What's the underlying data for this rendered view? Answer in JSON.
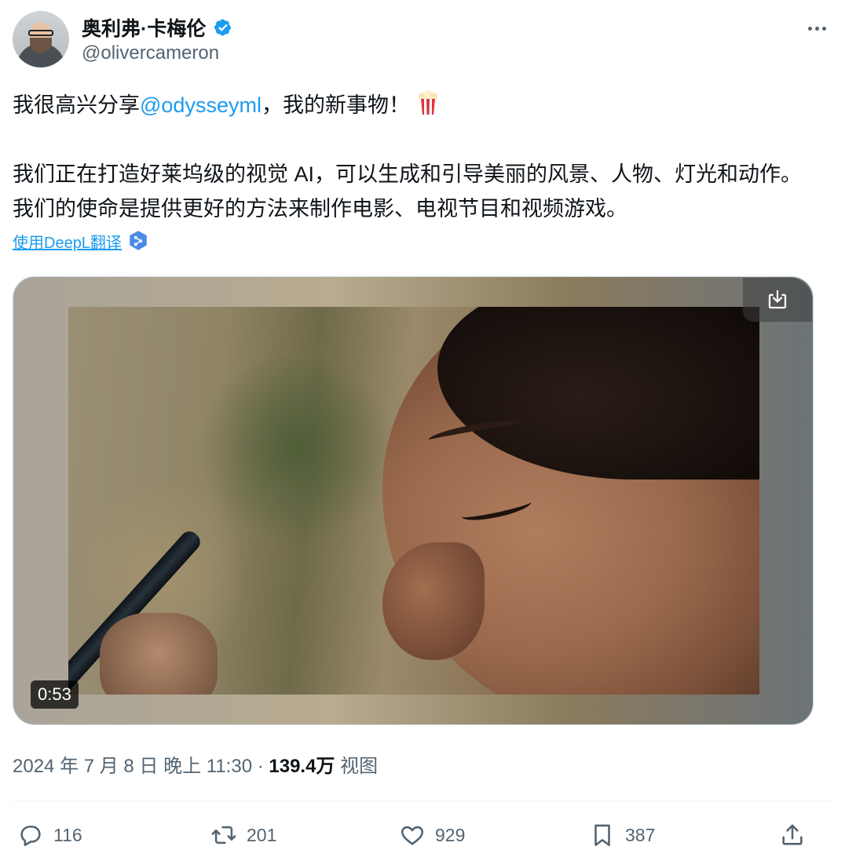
{
  "author": {
    "name": "奥利弗·卡梅伦",
    "handle": "@olivercameron",
    "verified_color": "#1d9bf0"
  },
  "tweet": {
    "text_part1": "我很高兴分享",
    "mention": "@odysseyml",
    "text_part2": "，我的新事物！",
    "emoji": "popcorn-icon",
    "paragraph2": "我们正在打造好莱坞级的视觉 AI，可以生成和引导美丽的风景、人物、灯光和动作。我们的使命是提供更好的方法来制作电影、电视节目和视频游戏。"
  },
  "translate": {
    "label": "使用DeepL翻译"
  },
  "media": {
    "duration": "0:53"
  },
  "meta": {
    "timestamp": "2024 年 7 月 8 日 晚上 11:30",
    "separator": " · ",
    "views_count": "139.4万",
    "views_label": "视图"
  },
  "actions": {
    "replies": "116",
    "retweets": "201",
    "likes": "929",
    "bookmarks": "387"
  },
  "colors": {
    "accent": "#1d9bf0",
    "secondary_text": "#536471",
    "primary_text": "#0f1419"
  }
}
